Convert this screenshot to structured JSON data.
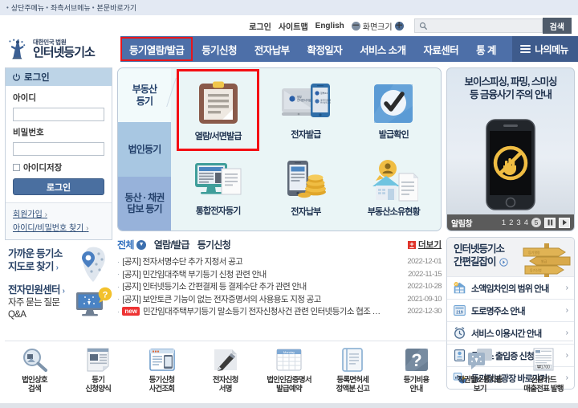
{
  "skip_links": [
    "상단주메뉴",
    "좌측서브메뉴",
    "본문바로가기"
  ],
  "utility": {
    "login": "로그인",
    "sitemap": "사이트맵",
    "english": "English",
    "screen_size": "화면크기",
    "zoom_out": "－",
    "zoom_in": "＋",
    "search_placeholder": "",
    "search_value": "",
    "search_button": "검색"
  },
  "logo": {
    "line1": "대한민국 법원",
    "line2": "인터넷등기소"
  },
  "nav": {
    "items": [
      {
        "label": "등기열람/발급",
        "highlighted": true
      },
      {
        "label": "등기신청",
        "highlighted": false
      },
      {
        "label": "전자납부",
        "highlighted": false
      },
      {
        "label": "확정일자",
        "highlighted": false
      },
      {
        "label": "서비스 소개",
        "highlighted": false
      },
      {
        "label": "자료센터",
        "highlighted": false
      },
      {
        "label": "통 계",
        "highlighted": false
      }
    ],
    "mymenu": "나의메뉴",
    "bar_color": "#4d6fa8",
    "mymenu_color": "#3e5b8c",
    "highlight_color": "#e8161b"
  },
  "login_panel": {
    "title": "로그인",
    "id_label": "아이디",
    "id_value": "",
    "pw_label": "비밀번호",
    "pw_value": "",
    "remember_label": "아이디저장",
    "submit": "로그인",
    "links": [
      "회원가입",
      "아이디/비밀번호 찾기"
    ]
  },
  "left_promos": [
    {
      "line1": "가까운 등기소",
      "line2": "지도로 찾기",
      "arrow": "›",
      "icon": "map-pin-icon"
    },
    {
      "line1": "전자민원센터",
      "line2": "자주 묻는 질문",
      "line3": "Q&A",
      "arrow": "›",
      "icon": "monitor-question-icon"
    }
  ],
  "service_panel": {
    "tabs": [
      {
        "label": "부동산\n등기",
        "l1": "부동산",
        "l2": "등기",
        "active": true
      },
      {
        "label": "법인등기",
        "l1": "법인등기",
        "l2": "",
        "active": false
      },
      {
        "label": "동산·채권 담보 등기",
        "l1": "동산 · 채권",
        "l2": "담보 등기",
        "active": false
      }
    ],
    "cells": [
      {
        "label": "열람/서면발급",
        "icon": "clipboard-icon",
        "highlighted": true
      },
      {
        "label": "전자발급",
        "icon": "tablet-phone-icon",
        "highlighted": false
      },
      {
        "label": "발급확인",
        "icon": "checkmark-badge-icon",
        "highlighted": false
      },
      {
        "label": "통합전자등기",
        "icon": "monitor-document-icon",
        "highlighted": false
      },
      {
        "label": "전자납부",
        "icon": "phone-coins-icon",
        "highlighted": false
      },
      {
        "label": "부동산소유현황",
        "icon": "house-person-icon",
        "highlighted": false
      }
    ]
  },
  "banner": {
    "title_line1": "보이스피싱, 파밍, 스미싱",
    "title_line2": "등 금융사기 주의 안내",
    "label": "알림창",
    "pages": [
      "1",
      "2",
      "3",
      "4",
      "5"
    ],
    "active_page": "5",
    "pause": "❙❙",
    "next": "▶"
  },
  "notices": {
    "tabs": [
      {
        "label": "전체",
        "active": true
      },
      {
        "label": "열람/발급",
        "active": false
      },
      {
        "label": "등기신청",
        "active": false
      }
    ],
    "more": "더보기",
    "items": [
      {
        "text": "[공지] 전자서명수단 추가 지정서 공고",
        "date": "2022-12-01",
        "new": false
      },
      {
        "text": "[공지] 민간임대주택 부기등기 신청 관련 안내",
        "date": "2022-11-15",
        "new": false
      },
      {
        "text": "[공지] 인터넷등기소 간편결제 등 결제수단 추가 관련 안내",
        "date": "2022-10-28",
        "new": false
      },
      {
        "text": "[공지] 보안토큰 기능이 없는 전자증명서의 사용용도 지정 공고",
        "date": "2021-09-10",
        "new": false
      },
      {
        "text": "민간임대주택부기등기 말소등기 전자신청사건 관련 인터넷등기소 협조 …",
        "date": "2022-12-30",
        "new": true,
        "badge": "new"
      }
    ]
  },
  "quick_links": {
    "header_line1": "인터넷등기소",
    "header_line2": "간편길잡이",
    "items": [
      {
        "label": "소액임차인의 범위 안내",
        "icon": "house-w-icon",
        "arrow": "›"
      },
      {
        "label": "도로명주소 안내",
        "icon": "address-sign-icon",
        "arrow": "›"
      },
      {
        "label": "서비스 이용시간 안내",
        "icon": "alarm-clock-icon",
        "arrow": "›"
      },
      {
        "label": "등기소 출입증 신청관리",
        "icon": "id-card-icon",
        "arrow": "›"
      },
      {
        "label": "등기정보광장 바로가기",
        "icon": "chart-pie-icon",
        "arrow": "›"
      }
    ]
  },
  "bottom_strip": [
    {
      "l1": "법인상호",
      "l2": "검색",
      "icon": "magnifier-icon"
    },
    {
      "l1": "등기",
      "l2": "신청양식",
      "icon": "document-form-icon"
    },
    {
      "l1": "등기신청",
      "l2": "사건조회",
      "icon": "window-search-icon"
    },
    {
      "l1": "전자신청",
      "l2": "서명",
      "icon": "pen-sign-icon"
    },
    {
      "l1": "법인인감증명서",
      "l2": "발급예약",
      "icon": "calendar-icon"
    },
    {
      "l1": "등록면허세",
      "l2": "정액분 신고",
      "icon": "book-icon"
    },
    {
      "l1": "등기비용",
      "l2": "안내",
      "icon": "question-icon"
    },
    {
      "l1": "직권말소통지등",
      "l2": "보기",
      "icon": "notice-icon"
    },
    {
      "l1": "신용카드",
      "l2": "매출전표 발행",
      "icon": "receipt-icon"
    }
  ]
}
